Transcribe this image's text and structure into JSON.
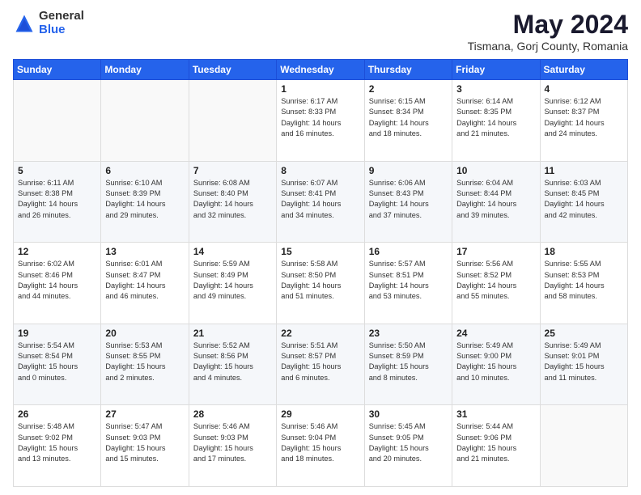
{
  "header": {
    "logo_general": "General",
    "logo_blue": "Blue",
    "month_title": "May 2024",
    "location": "Tismana, Gorj County, Romania"
  },
  "weekdays": [
    "Sunday",
    "Monday",
    "Tuesday",
    "Wednesday",
    "Thursday",
    "Friday",
    "Saturday"
  ],
  "weeks": [
    [
      {
        "day": "",
        "info": ""
      },
      {
        "day": "",
        "info": ""
      },
      {
        "day": "",
        "info": ""
      },
      {
        "day": "1",
        "info": "Sunrise: 6:17 AM\nSunset: 8:33 PM\nDaylight: 14 hours\nand 16 minutes."
      },
      {
        "day": "2",
        "info": "Sunrise: 6:15 AM\nSunset: 8:34 PM\nDaylight: 14 hours\nand 18 minutes."
      },
      {
        "day": "3",
        "info": "Sunrise: 6:14 AM\nSunset: 8:35 PM\nDaylight: 14 hours\nand 21 minutes."
      },
      {
        "day": "4",
        "info": "Sunrise: 6:12 AM\nSunset: 8:37 PM\nDaylight: 14 hours\nand 24 minutes."
      }
    ],
    [
      {
        "day": "5",
        "info": "Sunrise: 6:11 AM\nSunset: 8:38 PM\nDaylight: 14 hours\nand 26 minutes."
      },
      {
        "day": "6",
        "info": "Sunrise: 6:10 AM\nSunset: 8:39 PM\nDaylight: 14 hours\nand 29 minutes."
      },
      {
        "day": "7",
        "info": "Sunrise: 6:08 AM\nSunset: 8:40 PM\nDaylight: 14 hours\nand 32 minutes."
      },
      {
        "day": "8",
        "info": "Sunrise: 6:07 AM\nSunset: 8:41 PM\nDaylight: 14 hours\nand 34 minutes."
      },
      {
        "day": "9",
        "info": "Sunrise: 6:06 AM\nSunset: 8:43 PM\nDaylight: 14 hours\nand 37 minutes."
      },
      {
        "day": "10",
        "info": "Sunrise: 6:04 AM\nSunset: 8:44 PM\nDaylight: 14 hours\nand 39 minutes."
      },
      {
        "day": "11",
        "info": "Sunrise: 6:03 AM\nSunset: 8:45 PM\nDaylight: 14 hours\nand 42 minutes."
      }
    ],
    [
      {
        "day": "12",
        "info": "Sunrise: 6:02 AM\nSunset: 8:46 PM\nDaylight: 14 hours\nand 44 minutes."
      },
      {
        "day": "13",
        "info": "Sunrise: 6:01 AM\nSunset: 8:47 PM\nDaylight: 14 hours\nand 46 minutes."
      },
      {
        "day": "14",
        "info": "Sunrise: 5:59 AM\nSunset: 8:49 PM\nDaylight: 14 hours\nand 49 minutes."
      },
      {
        "day": "15",
        "info": "Sunrise: 5:58 AM\nSunset: 8:50 PM\nDaylight: 14 hours\nand 51 minutes."
      },
      {
        "day": "16",
        "info": "Sunrise: 5:57 AM\nSunset: 8:51 PM\nDaylight: 14 hours\nand 53 minutes."
      },
      {
        "day": "17",
        "info": "Sunrise: 5:56 AM\nSunset: 8:52 PM\nDaylight: 14 hours\nand 55 minutes."
      },
      {
        "day": "18",
        "info": "Sunrise: 5:55 AM\nSunset: 8:53 PM\nDaylight: 14 hours\nand 58 minutes."
      }
    ],
    [
      {
        "day": "19",
        "info": "Sunrise: 5:54 AM\nSunset: 8:54 PM\nDaylight: 15 hours\nand 0 minutes."
      },
      {
        "day": "20",
        "info": "Sunrise: 5:53 AM\nSunset: 8:55 PM\nDaylight: 15 hours\nand 2 minutes."
      },
      {
        "day": "21",
        "info": "Sunrise: 5:52 AM\nSunset: 8:56 PM\nDaylight: 15 hours\nand 4 minutes."
      },
      {
        "day": "22",
        "info": "Sunrise: 5:51 AM\nSunset: 8:57 PM\nDaylight: 15 hours\nand 6 minutes."
      },
      {
        "day": "23",
        "info": "Sunrise: 5:50 AM\nSunset: 8:59 PM\nDaylight: 15 hours\nand 8 minutes."
      },
      {
        "day": "24",
        "info": "Sunrise: 5:49 AM\nSunset: 9:00 PM\nDaylight: 15 hours\nand 10 minutes."
      },
      {
        "day": "25",
        "info": "Sunrise: 5:49 AM\nSunset: 9:01 PM\nDaylight: 15 hours\nand 11 minutes."
      }
    ],
    [
      {
        "day": "26",
        "info": "Sunrise: 5:48 AM\nSunset: 9:02 PM\nDaylight: 15 hours\nand 13 minutes."
      },
      {
        "day": "27",
        "info": "Sunrise: 5:47 AM\nSunset: 9:03 PM\nDaylight: 15 hours\nand 15 minutes."
      },
      {
        "day": "28",
        "info": "Sunrise: 5:46 AM\nSunset: 9:03 PM\nDaylight: 15 hours\nand 17 minutes."
      },
      {
        "day": "29",
        "info": "Sunrise: 5:46 AM\nSunset: 9:04 PM\nDaylight: 15 hours\nand 18 minutes."
      },
      {
        "day": "30",
        "info": "Sunrise: 5:45 AM\nSunset: 9:05 PM\nDaylight: 15 hours\nand 20 minutes."
      },
      {
        "day": "31",
        "info": "Sunrise: 5:44 AM\nSunset: 9:06 PM\nDaylight: 15 hours\nand 21 minutes."
      },
      {
        "day": "",
        "info": ""
      }
    ]
  ]
}
